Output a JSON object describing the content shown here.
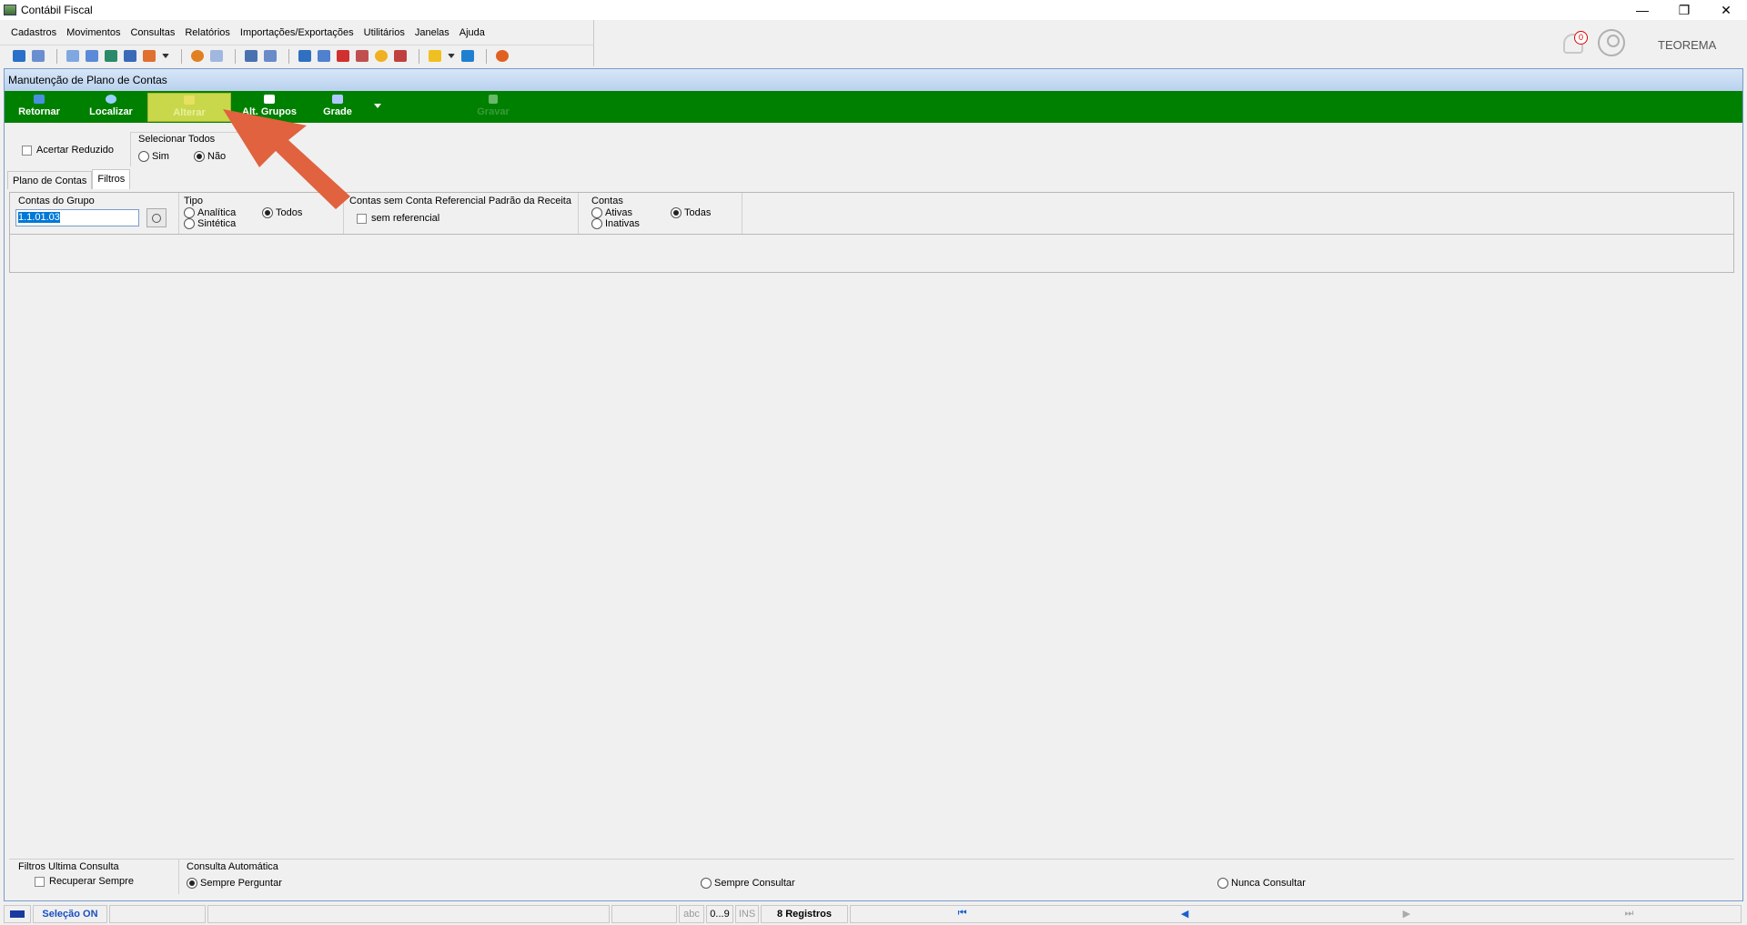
{
  "window": {
    "title": "Contábil Fiscal",
    "minimize": "—",
    "restore": "❐",
    "close": "✕"
  },
  "menu": [
    "Cadastros",
    "Movimentos",
    "Consultas",
    "Relatórios",
    "Importações/Exportações",
    "Utilitários",
    "Janelas",
    "Ajuda"
  ],
  "header": {
    "notification_count": "0",
    "user": "TEOREMA"
  },
  "form": {
    "title": "Manutenção de Plano de Contas",
    "buttons": {
      "retornar": "Retornar",
      "localizar": "Localizar",
      "alterar": "Alterar",
      "alt_grupos": "Alt. Grupos",
      "grade": "Grade",
      "gravar": "Gravar"
    },
    "acertar_reduzido": "Acertar Reduzido",
    "selecionar_todos": {
      "label": "Selecionar Todos",
      "sim": "Sim",
      "nao": "Não",
      "selected": "Não"
    },
    "tabs": [
      "Plano de Contas",
      "Filtros"
    ],
    "active_tab": "Filtros",
    "filters": {
      "contas_grupo": {
        "label": "Contas do Grupo",
        "value": "1.1.01.03"
      },
      "tipo": {
        "label": "Tipo",
        "analitica": "Analítica",
        "sintetica": "Sintética",
        "todos": "Todos",
        "selected": "Todos"
      },
      "referencial": {
        "label": "Contas sem Conta Referencial Padrão da Receita",
        "option": "sem referencial"
      },
      "contas": {
        "label": "Contas",
        "ativas": "Ativas",
        "inativas": "Inativas",
        "todas": "Todas",
        "selected": "Todas"
      }
    },
    "bottom": {
      "filtros_label": "Filtros Ultima Consulta",
      "recuperar": "Recuperar Sempre",
      "consulta_label": "Consulta Automática",
      "sempre_perguntar": "Sempre Perguntar",
      "sempre_consultar": "Sempre Consultar",
      "nunca_consultar": "Nunca Consultar",
      "selected": "Sempre Perguntar"
    }
  },
  "status": {
    "selecao": "Seleção ON",
    "abc": "abc",
    "num": "0...9",
    "ins": "INS",
    "registros": "8 Registros"
  },
  "colors": {
    "green_bar": "#008000",
    "highlight": "#c8d84a",
    "arrow": "#e0623f",
    "title_bg": "#c6dbf2"
  }
}
